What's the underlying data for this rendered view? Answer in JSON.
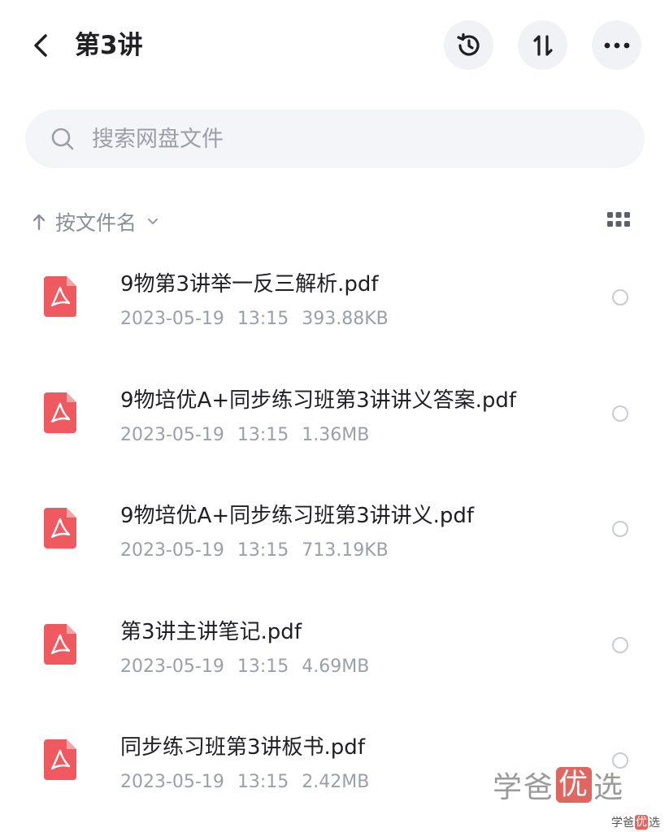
{
  "header": {
    "title": "第3讲"
  },
  "search": {
    "placeholder": "搜索网盘文件"
  },
  "sort": {
    "label": "按文件名"
  },
  "icons": {
    "back": "chevron-left-icon",
    "history": "history-icon",
    "sort": "sort-arrows-icon",
    "more": "more-dots-icon",
    "search": "search-icon",
    "grid": "grid-view-icon",
    "file": "pdf-icon"
  },
  "colors": {
    "pdf_red": "#ee5a5f",
    "button_bg": "#f1f2f5",
    "search_bg": "#f3f5f9",
    "secondary_text": "#9a9fa8"
  },
  "files": [
    {
      "name": "9物第3讲举一反三解析.pdf",
      "date": "2023-05-19",
      "time": "13:15",
      "size": "393.88KB"
    },
    {
      "name": "9物培优A+同步练习班第3讲讲义答案.pdf",
      "date": "2023-05-19",
      "time": "13:15",
      "size": "1.36MB"
    },
    {
      "name": "9物培优A+同步练习班第3讲讲义.pdf",
      "date": "2023-05-19",
      "time": "13:15",
      "size": "713.19KB"
    },
    {
      "name": "第3讲主讲笔记.pdf",
      "date": "2023-05-19",
      "time": "13:15",
      "size": "4.69MB"
    },
    {
      "name": "同步练习班第3讲板书.pdf",
      "date": "2023-05-19",
      "time": "13:15",
      "size": "2.42MB"
    }
  ],
  "watermark": {
    "part1": "学爸",
    "part2": "优",
    "part3": "选"
  }
}
